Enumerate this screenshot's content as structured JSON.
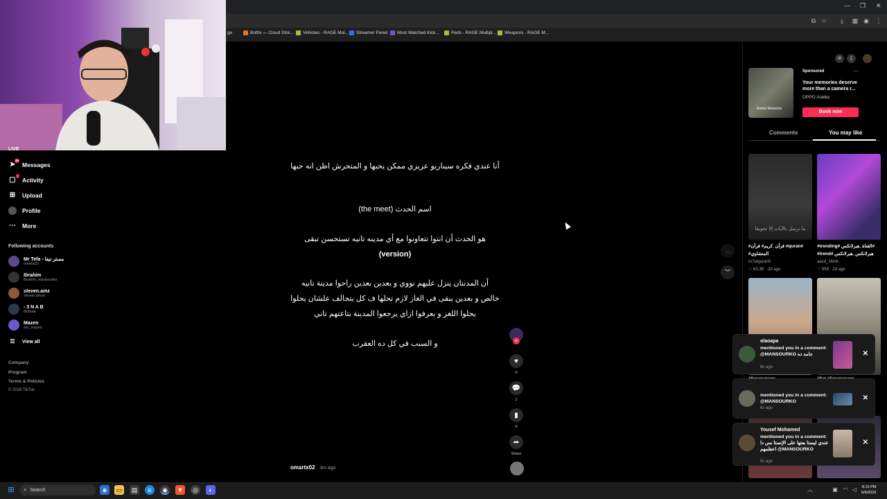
{
  "bookmarks": [
    "Botfix — Cloud Stre...",
    "Vehicles - RAGE Mul...",
    "Streamer Panel",
    "Most Watched Kick...",
    "Peds - RAGE Multipl...",
    "Weapons - RAGE M..."
  ],
  "bookmark_partial": "ge",
  "sidebar": {
    "live_label": "LIVE",
    "messages_label": "Messages",
    "messages_badge": "35",
    "activity_label": "Activity",
    "upload_label": "Upload",
    "profile_label": "Profile",
    "more_label": "More",
    "following_heading": "Following accounts",
    "accounts": [
      {
        "name": "Mr Tefa - مستر تيفا",
        "handle": "mrtefa20",
        "color": "#5a4a8a"
      },
      {
        "name": "Ibrahim",
        "handle": "ibrahim_mansourko",
        "color": "#333"
      },
      {
        "name": "steven.amz",
        "handle": "steven.amz0",
        "color": "#8a5a3a"
      },
      {
        "name": "- 3 N A B",
        "handle": "ifs3nab",
        "color": "#2e3a4a"
      },
      {
        "name": "Mazen",
        "handle": "zm_mazen",
        "color": "#6a5acd"
      }
    ],
    "view_all": "View all",
    "footer": [
      "Company",
      "Program",
      "Terms & Policies",
      "© 2026 TikTok"
    ]
  },
  "post": {
    "lines": [
      "أنا عندي فكره سيناريو عزيزي ممكن يحبها و المتحرش اظن انه حبها",
      "اسم الحدث (the meet)",
      "هو الحدث أن انتوا تتعاونوا مع أي مدينه تانيه تستحسن تبقى",
      "(version)",
      "أن المدنتان ينزل عليهم نووي و بعدين بعدين راحوا مدينة تانيه",
      "خالص و بعدين يبقى في الغاز لازم تحلها ف كل يتحالف علشان يحلوا",
      "يحلوا اللغز و بعرفوا ازاي يرجعوا المدينة بتاعتهم تاني",
      "و السبب في كل ده العقرب"
    ],
    "author": "omartx02",
    "time": "· 3m ago",
    "likes": "0",
    "comments": "1",
    "saves": "0",
    "share_label": "Share"
  },
  "ad": {
    "label": "Sponsored",
    "title": "Your memories deserve more than a camera r...",
    "brand": "OPPO Arabia",
    "cta": "Book now",
    "thumb_text": "Remix Moments"
  },
  "tabs": {
    "comments": "Comments",
    "you_may_like": "You may like"
  },
  "grid": [
    {
      "caption": "#quran# قرآن_كريم# قرآن#",
      "caption2": "المنشاوي#",
      "author": "ro7elquran0",
      "views": "♡ 63.3K",
      "time": "· 2d ago",
      "overlay": "ما نرسل بالآيات إلا تخويفا"
    },
    {
      "caption": "#trending# القناة_هبرلانكس#",
      "caption2": "#trend# هبرلانكس_هبرلانكس",
      "author": "aacd_16mk",
      "views": "♡ 559",
      "time": "· 2d ago"
    },
    {
      "caption": "#foryoupage...",
      "author": "",
      "views": "",
      "time": ""
    },
    {
      "caption": "#fyp #foryoupage...",
      "author": "",
      "views": "",
      "time": ""
    }
  ],
  "notifications": [
    {
      "name": "olaoapa",
      "text": "mentioned you in a comment: @MANSOURKO جامد ده",
      "time": "8s ago"
    },
    {
      "name": "",
      "text": "mentioned you in a comment: @MANSOURKO",
      "time": "6s ago"
    },
    {
      "name": "Yousef Mohamed",
      "text": "mentioned you in a comment: عندي ليستا بعتها على الإنستا بس دا اعظمهم @MANSOURKO",
      "time": "5s ago"
    }
  ],
  "taskbar": {
    "search_placeholder": "Search",
    "time": "8:15 PM",
    "date": "6/6/2026"
  }
}
